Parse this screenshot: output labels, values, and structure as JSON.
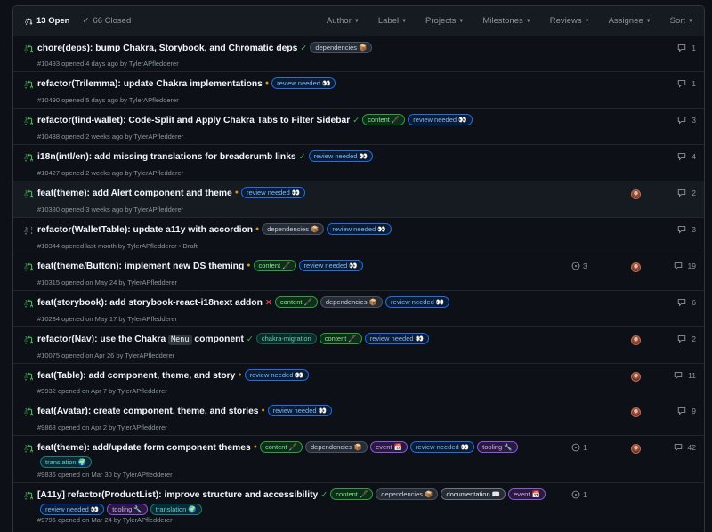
{
  "header": {
    "open_label": "13 Open",
    "closed_label": "66 Closed",
    "filters": [
      "Author",
      "Label",
      "Projects",
      "Milestones",
      "Reviews",
      "Assignee",
      "Sort"
    ]
  },
  "prs": [
    {
      "title": "chore(deps): bump Chakra, Storybook, and Chromatic deps",
      "status": "success",
      "labels": [
        {
          "text": "dependencies 📦",
          "kind": "dependencies"
        }
      ],
      "meta": "#10493 opened 4 days ago by TylerAPfledderer",
      "comments": "1",
      "draft": false
    },
    {
      "title": "refactor(Trilemma): update Chakra implementations",
      "status": "pending",
      "labels": [
        {
          "text": "review needed 👀",
          "kind": "review"
        }
      ],
      "meta": "#10490 opened 5 days ago by TylerAPfledderer",
      "comments": "1",
      "draft": false
    },
    {
      "title": "refactor(find-wallet): Code-Split and Apply Chakra Tabs to Filter Sidebar",
      "status": "success",
      "labels": [
        {
          "text": "content 🖋️",
          "kind": "content"
        },
        {
          "text": "review needed 👀",
          "kind": "review"
        }
      ],
      "meta": "#10438 opened 2 weeks ago by TylerAPfledderer",
      "comments": "3",
      "draft": false
    },
    {
      "title": "i18n(intl/en): add missing translations for breadcrumb links",
      "status": "success",
      "labels": [
        {
          "text": "review needed 👀",
          "kind": "review"
        }
      ],
      "meta": "#10427 opened 2 weeks ago by TylerAPfledderer",
      "comments": "4",
      "draft": false
    },
    {
      "title": "feat(theme): add Alert component and theme",
      "status": "pending",
      "labels": [
        {
          "text": "review needed 👀",
          "kind": "review"
        }
      ],
      "meta": "#10380 opened 3 weeks ago by TylerAPfledderer",
      "comments": "2",
      "avatar": true,
      "draft": false,
      "highlight": true
    },
    {
      "title": "refactor(WalletTable): update a11y with accordion",
      "status": "pending",
      "labels": [
        {
          "text": "dependencies 📦",
          "kind": "dependencies"
        },
        {
          "text": "review needed 👀",
          "kind": "review"
        }
      ],
      "meta": "#10344 opened last month by TylerAPfledderer • Draft",
      "comments": "3",
      "draft": true
    },
    {
      "title": "feat(theme/Button): implement new DS theming",
      "status": "pending",
      "labels": [
        {
          "text": "content 🖋️",
          "kind": "content"
        },
        {
          "text": "review needed 👀",
          "kind": "review"
        }
      ],
      "meta": "#10315 opened on May 24 by TylerAPfledderer",
      "comments": "19",
      "avatar": true,
      "review": "3",
      "draft": false
    },
    {
      "title": "feat(storybook): add storybook-react-i18next addon",
      "status": "fail",
      "labels": [
        {
          "text": "content 🖋️",
          "kind": "content"
        },
        {
          "text": "dependencies 📦",
          "kind": "dependencies"
        },
        {
          "text": "review needed 👀",
          "kind": "review"
        }
      ],
      "meta": "#10234 opened on May 17 by TylerAPfledderer",
      "comments": "6",
      "draft": false
    },
    {
      "title_parts": [
        "refactor(Nav): use the Chakra ",
        "Menu",
        " component"
      ],
      "status": "success",
      "labels": [
        {
          "text": "chakra-migration",
          "kind": "chakra"
        },
        {
          "text": "content 🖋️",
          "kind": "content"
        },
        {
          "text": "review needed 👀",
          "kind": "review"
        }
      ],
      "meta": "#10075 opened on Apr 26 by TylerAPfledderer",
      "comments": "2",
      "avatar": true,
      "draft": false
    },
    {
      "title": "feat(Table): add component, theme, and story",
      "status": "pending",
      "labels": [
        {
          "text": "review needed 👀",
          "kind": "review"
        }
      ],
      "meta": "#9932 opened on Apr 7 by TylerAPfledderer",
      "comments": "11",
      "avatar": true,
      "draft": false
    },
    {
      "title": "feat(Avatar): create component, theme, and stories",
      "status": "pending",
      "labels": [
        {
          "text": "review needed 👀",
          "kind": "review"
        }
      ],
      "meta": "#9868 opened on Apr 2 by TylerAPfledderer",
      "comments": "9",
      "avatar": true,
      "draft": false
    },
    {
      "title": "feat(theme): add/update form component themes",
      "status": "pending",
      "labels": [
        {
          "text": "content 🖋️",
          "kind": "content"
        },
        {
          "text": "dependencies 📦",
          "kind": "dependencies"
        },
        {
          "text": "event 📅",
          "kind": "event"
        },
        {
          "text": "review needed 👀",
          "kind": "review"
        },
        {
          "text": "tooling 🔧",
          "kind": "tooling"
        },
        {
          "text": "translation 🌍",
          "kind": "translation"
        }
      ],
      "meta": "#9836 opened on Mar 30 by TylerAPfledderer",
      "comments": "42",
      "avatar": true,
      "review": "1",
      "draft": false
    },
    {
      "title": "[A11y] refactor(ProductList): improve structure and accessibility",
      "status": "success",
      "labels": [
        {
          "text": "content 🖋️",
          "kind": "content"
        },
        {
          "text": "dependencies 📦",
          "kind": "dependencies"
        },
        {
          "text": "documentation 📖",
          "kind": "documentation"
        },
        {
          "text": "event 📅",
          "kind": "event"
        },
        {
          "text": "review needed 👀",
          "kind": "review"
        },
        {
          "text": "tooling 🔧",
          "kind": "tooling"
        },
        {
          "text": "translation 🌍",
          "kind": "translation"
        }
      ],
      "meta": "#9795 opened on Mar 24 by TylerAPfledderer",
      "comments": "",
      "review": "1",
      "draft": false
    }
  ]
}
